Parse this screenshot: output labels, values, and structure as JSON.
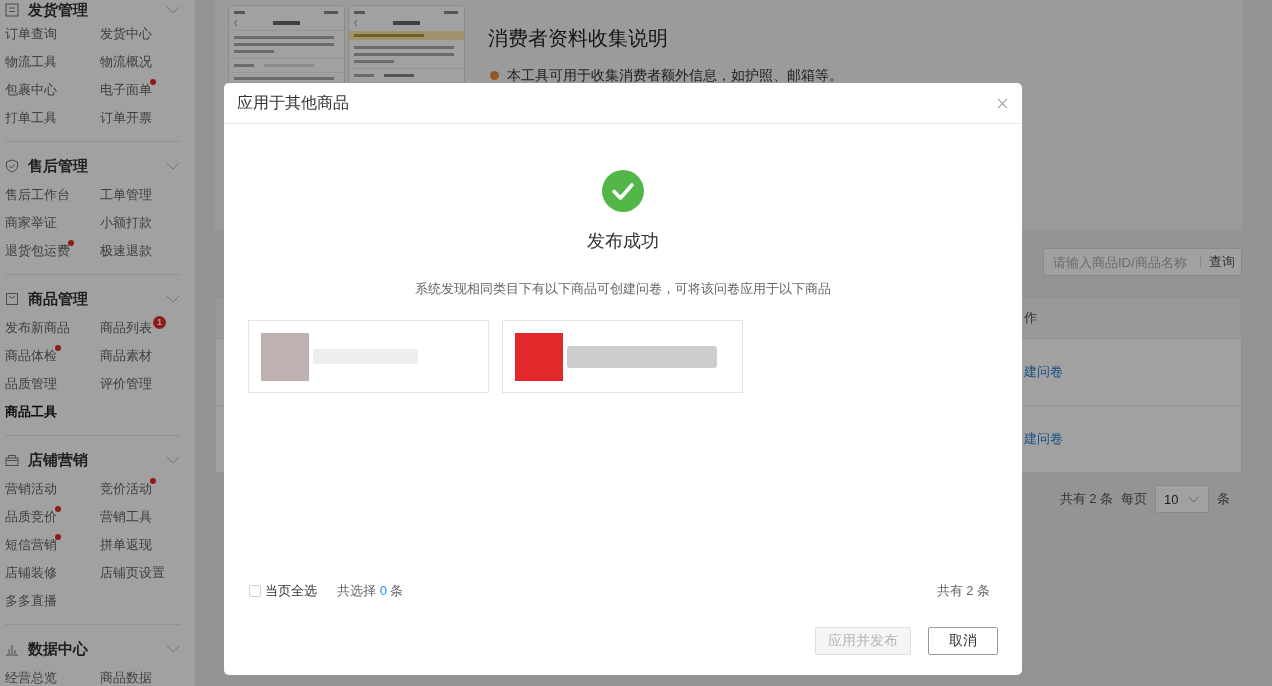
{
  "sidebar": {
    "sections": [
      {
        "title": "发货管理",
        "items": [
          {
            "label": "订单查询",
            "selected": false,
            "dot": false
          },
          {
            "label": "发货中心",
            "selected": false,
            "dot": false
          },
          {
            "label": "物流工具",
            "selected": false,
            "dot": false
          },
          {
            "label": "物流概况",
            "selected": false,
            "dot": false
          },
          {
            "label": "包裹中心",
            "selected": false,
            "dot": false
          },
          {
            "label": "电子面单",
            "selected": false,
            "dot": true
          },
          {
            "label": "打单工具",
            "selected": false,
            "dot": false
          },
          {
            "label": "订单开票",
            "selected": false,
            "dot": false
          }
        ]
      },
      {
        "title": "售后管理",
        "items": [
          {
            "label": "售后工作台",
            "selected": false,
            "dot": false
          },
          {
            "label": "工单管理",
            "selected": false,
            "dot": false
          },
          {
            "label": "商家举证",
            "selected": false,
            "dot": false
          },
          {
            "label": "小额打款",
            "selected": false,
            "dot": false
          },
          {
            "label": "退货包运费",
            "selected": false,
            "dot": true
          },
          {
            "label": "极速退款",
            "selected": false,
            "dot": false
          }
        ]
      },
      {
        "title": "商品管理",
        "items": [
          {
            "label": "发布新商品",
            "selected": false,
            "dot": false
          },
          {
            "label": "商品列表",
            "selected": false,
            "dot": false,
            "badge": "1"
          },
          {
            "label": "商品体检",
            "selected": false,
            "dot": true
          },
          {
            "label": "商品素材",
            "selected": false,
            "dot": false
          },
          {
            "label": "品质管理",
            "selected": false,
            "dot": false
          },
          {
            "label": "评价管理",
            "selected": false,
            "dot": false
          },
          {
            "label": "商品工具",
            "selected": true,
            "dot": false
          }
        ]
      },
      {
        "title": "店铺营销",
        "items": [
          {
            "label": "营销活动",
            "selected": false,
            "dot": false
          },
          {
            "label": "竞价活动",
            "selected": false,
            "dot": true
          },
          {
            "label": "品质竞价",
            "selected": false,
            "dot": true
          },
          {
            "label": "营销工具",
            "selected": false,
            "dot": false
          },
          {
            "label": "短信营销",
            "selected": false,
            "dot": true
          },
          {
            "label": "拼单返现",
            "selected": false,
            "dot": false
          },
          {
            "label": "店铺装修",
            "selected": false,
            "dot": false
          },
          {
            "label": "店铺页设置",
            "selected": false,
            "dot": false
          },
          {
            "label": "多多直播",
            "selected": false,
            "dot": false
          }
        ]
      },
      {
        "title": "数据中心",
        "items": [
          {
            "label": "经营总览",
            "selected": false,
            "dot": false
          },
          {
            "label": "商品数据",
            "selected": false,
            "dot": false
          }
        ]
      }
    ]
  },
  "intro": {
    "title": "消费者资料收集说明",
    "bullets": [
      "本工具可用于收集消费者额外信息，如护照、邮箱等。"
    ]
  },
  "search": {
    "placeholder": "请输入商品ID/商品名称",
    "button": "查询"
  },
  "table": {
    "columns": [
      "作"
    ],
    "rows": [
      [
        "建问卷"
      ],
      [
        "建问卷"
      ]
    ]
  },
  "pagination": {
    "total": "共有 2 条",
    "per_page_label": "每页",
    "per_page": "10",
    "unit": "条"
  },
  "dialog": {
    "title": "应用于其他商品",
    "status": "发布成功",
    "message": "系统发现相同类目下有以下商品可创建问卷，可将该问卷应用于以下商品",
    "products": [
      {
        "selected": false
      },
      {
        "selected": false
      }
    ],
    "select_all": {
      "label": "当页全选",
      "checked": false
    },
    "selection": {
      "prefix": "共选择",
      "count": "0",
      "suffix": "条"
    },
    "total": "共有 2 条",
    "buttons": [
      {
        "label": "应用并发布",
        "disabled": true
      },
      {
        "label": "取消",
        "disabled": false
      }
    ]
  }
}
